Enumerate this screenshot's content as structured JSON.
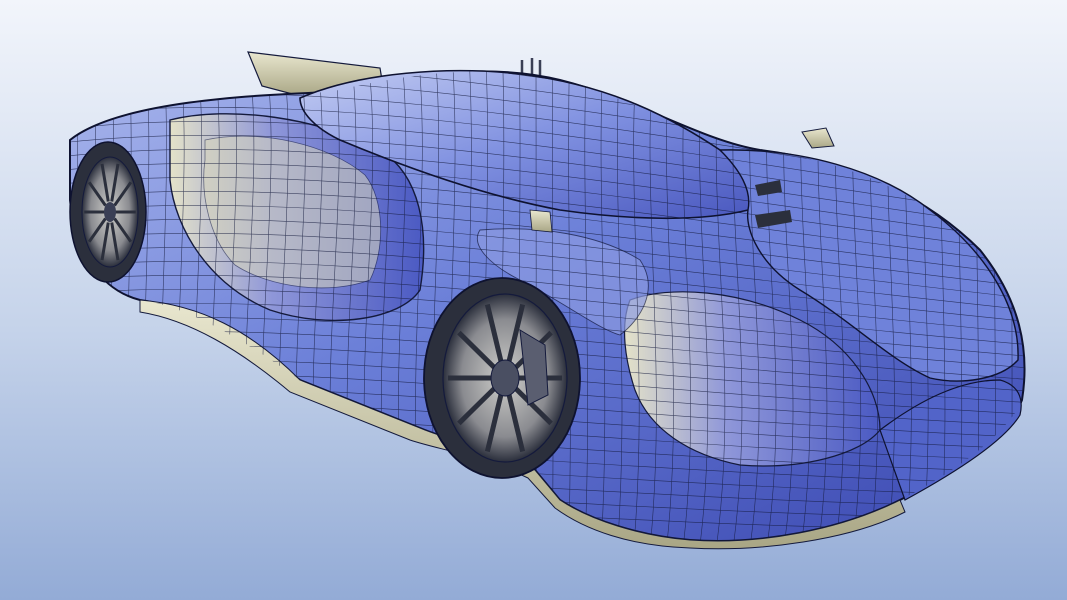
{
  "render": {
    "subject": "car-wireframe-render",
    "background_top": "#f2f5fb",
    "background_bottom": "#93abd6",
    "body_blue": "#5b6fd0",
    "body_blue_light": "#a9b6ec",
    "body_blue_dark": "#2a3596",
    "surface_cream": "#c9c6a4",
    "surface_cream_light": "#e9e7cf",
    "wire_color": "#141a3c",
    "wheel_dark": "#2b2f3c",
    "wheel_metal": "#b7b7b2"
  }
}
